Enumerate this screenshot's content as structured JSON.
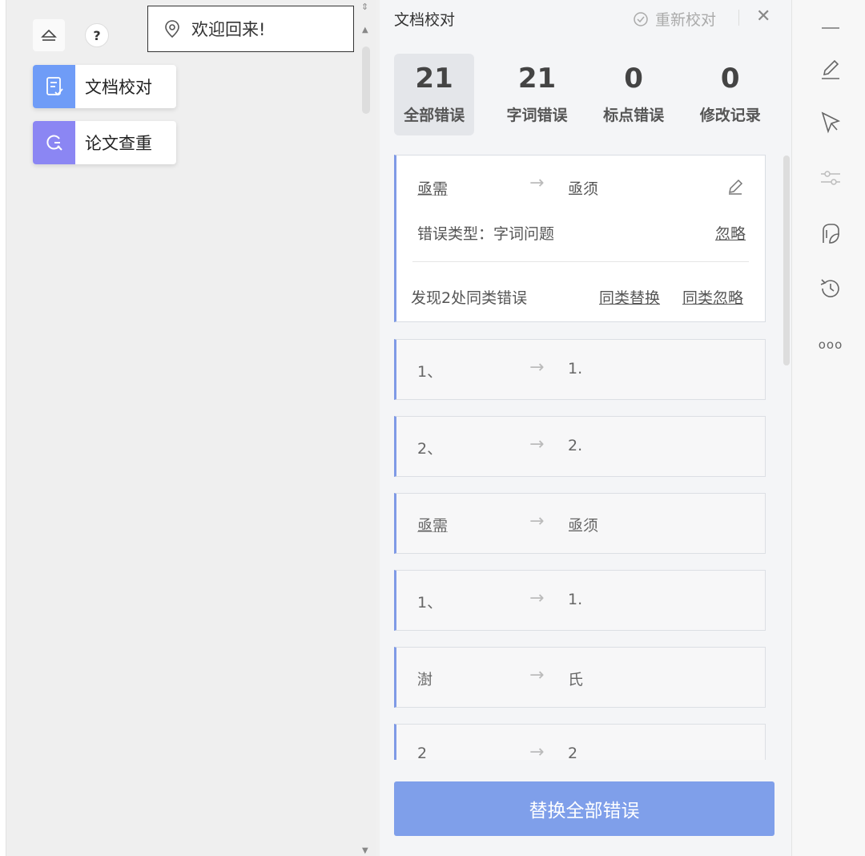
{
  "welcome": {
    "text": "欢迎回来!"
  },
  "left_features": [
    {
      "label": "文档校对",
      "color": "#6f9cf7"
    },
    {
      "label": "论文查重",
      "color": "#8b86f3"
    }
  ],
  "help": {
    "label": "?"
  },
  "panel": {
    "title": "文档校对",
    "recheck_label": "重新校对",
    "close_label": "✕",
    "stats": [
      {
        "num": "21",
        "caption": "全部错误"
      },
      {
        "num": "21",
        "caption": "字词错误"
      },
      {
        "num": "0",
        "caption": "标点错误"
      },
      {
        "num": "0",
        "caption": "修改记录"
      }
    ],
    "expanded": {
      "from": "亟需",
      "to": "亟须",
      "type_label": "错误类型：字词问题",
      "ignore": "忽略",
      "found_text": "发现2处同类错误",
      "replace_same": "同类替换",
      "ignore_same": "同类忽略"
    },
    "items": [
      {
        "from": "1、",
        "to": "1."
      },
      {
        "from": "2、",
        "to": "2."
      },
      {
        "from": "亟需",
        "to": "亟须"
      },
      {
        "from": "1、",
        "to": "1."
      },
      {
        "from": "澍",
        "to": "氏"
      },
      {
        "from": "2",
        "to": "2"
      }
    ],
    "arrow": "→",
    "replace_all": "替换全部错误"
  },
  "right_toolbar": {
    "icons": [
      "minus-icon",
      "pen-icon",
      "cursor-icon",
      "sliders-icon",
      "leaf-icon",
      "history-icon",
      "more-icon"
    ],
    "more_label": "ooo"
  },
  "colors": {
    "accent": "#7f9fea",
    "card_border_left": "#7f9ae6"
  }
}
